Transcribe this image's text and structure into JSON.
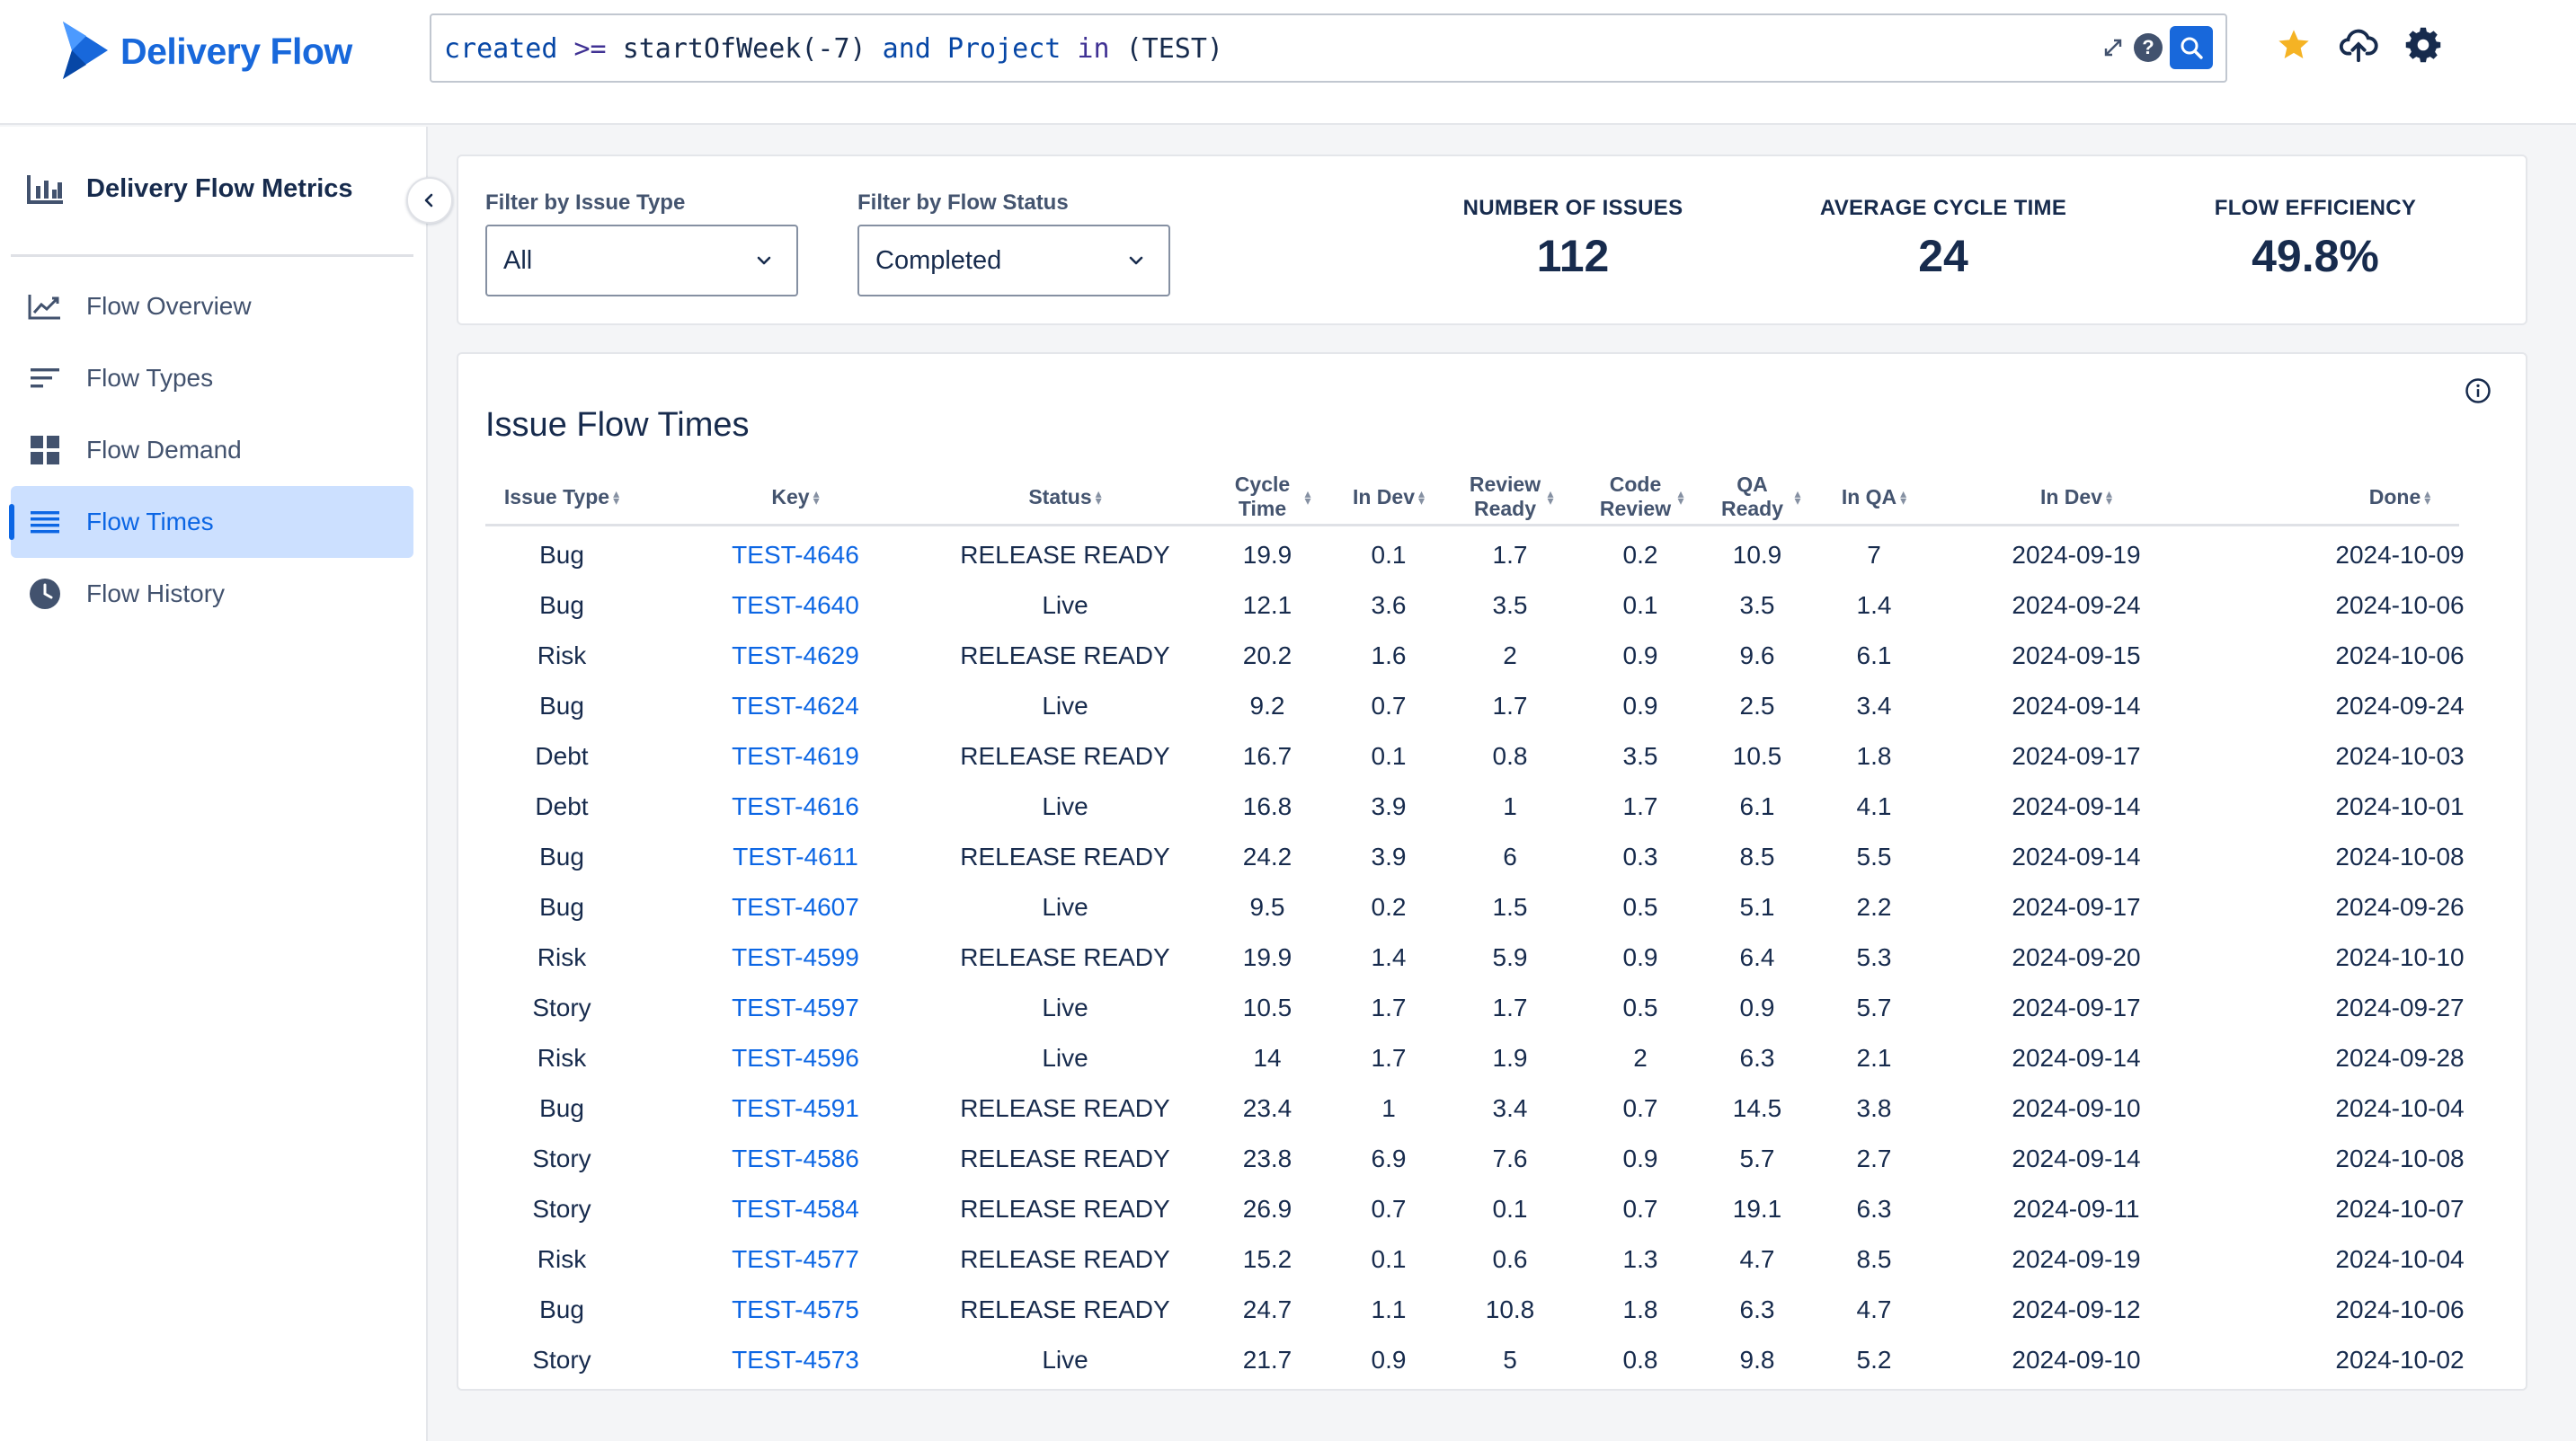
{
  "header": {
    "app_name": "Delivery Flow",
    "query": {
      "parts": [
        {
          "text": "created",
          "cls": "q-field"
        },
        {
          "text": " >= ",
          "cls": "q-op"
        },
        {
          "text": "startOfWeek(-7)",
          "cls": "q-fn"
        },
        {
          "text": " and ",
          "cls": "q-kw"
        },
        {
          "text": "Project",
          "cls": "q-field"
        },
        {
          "text": " in ",
          "cls": "q-op"
        },
        {
          "text": "(TEST)",
          "cls": "q-fn"
        }
      ]
    },
    "icons": [
      "star-icon",
      "cloud-upload-icon",
      "gear-icon"
    ],
    "colors": {
      "brand": "#1868DB",
      "star": "#F5B324"
    }
  },
  "sidebar": {
    "title": "Delivery Flow Metrics",
    "items": [
      {
        "label": "Flow Overview",
        "icon": "line-chart-icon",
        "active": false
      },
      {
        "label": "Flow Types",
        "icon": "lines-icon",
        "active": false
      },
      {
        "label": "Flow Demand",
        "icon": "grid-icon",
        "active": false
      },
      {
        "label": "Flow Times",
        "icon": "list-icon",
        "active": true
      },
      {
        "label": "Flow History",
        "icon": "clock-icon",
        "active": false
      }
    ]
  },
  "filters": {
    "issue_type": {
      "label": "Filter by Issue Type",
      "value": "All"
    },
    "flow_status": {
      "label": "Filter by Flow Status",
      "value": "Completed"
    }
  },
  "metrics": [
    {
      "label": "NUMBER OF ISSUES",
      "value": "112"
    },
    {
      "label": "AVERAGE CYCLE TIME",
      "value": "24"
    },
    {
      "label": "FLOW EFFICIENCY",
      "value": "49.8%"
    }
  ],
  "table": {
    "title": "Issue Flow Times",
    "columns": [
      "Issue Type",
      "Key",
      "Status",
      "Cycle Time",
      "In Dev",
      "Review Ready",
      "Code Review",
      "QA Ready",
      "In QA",
      "In Dev",
      "Done"
    ],
    "rows": [
      [
        "Bug",
        "TEST-4646",
        "RELEASE READY",
        "19.9",
        "0.1",
        "1.7",
        "0.2",
        "10.9",
        "7",
        "2024-09-19",
        "2024-10-09"
      ],
      [
        "Bug",
        "TEST-4640",
        "Live",
        "12.1",
        "3.6",
        "3.5",
        "0.1",
        "3.5",
        "1.4",
        "2024-09-24",
        "2024-10-06"
      ],
      [
        "Risk",
        "TEST-4629",
        "RELEASE READY",
        "20.2",
        "1.6",
        "2",
        "0.9",
        "9.6",
        "6.1",
        "2024-09-15",
        "2024-10-06"
      ],
      [
        "Bug",
        "TEST-4624",
        "Live",
        "9.2",
        "0.7",
        "1.7",
        "0.9",
        "2.5",
        "3.4",
        "2024-09-14",
        "2024-09-24"
      ],
      [
        "Debt",
        "TEST-4619",
        "RELEASE READY",
        "16.7",
        "0.1",
        "0.8",
        "3.5",
        "10.5",
        "1.8",
        "2024-09-17",
        "2024-10-03"
      ],
      [
        "Debt",
        "TEST-4616",
        "Live",
        "16.8",
        "3.9",
        "1",
        "1.7",
        "6.1",
        "4.1",
        "2024-09-14",
        "2024-10-01"
      ],
      [
        "Bug",
        "TEST-4611",
        "RELEASE READY",
        "24.2",
        "3.9",
        "6",
        "0.3",
        "8.5",
        "5.5",
        "2024-09-14",
        "2024-10-08"
      ],
      [
        "Bug",
        "TEST-4607",
        "Live",
        "9.5",
        "0.2",
        "1.5",
        "0.5",
        "5.1",
        "2.2",
        "2024-09-17",
        "2024-09-26"
      ],
      [
        "Risk",
        "TEST-4599",
        "RELEASE READY",
        "19.9",
        "1.4",
        "5.9",
        "0.9",
        "6.4",
        "5.3",
        "2024-09-20",
        "2024-10-10"
      ],
      [
        "Story",
        "TEST-4597",
        "Live",
        "10.5",
        "1.7",
        "1.7",
        "0.5",
        "0.9",
        "5.7",
        "2024-09-17",
        "2024-09-27"
      ],
      [
        "Risk",
        "TEST-4596",
        "Live",
        "14",
        "1.7",
        "1.9",
        "2",
        "6.3",
        "2.1",
        "2024-09-14",
        "2024-09-28"
      ],
      [
        "Bug",
        "TEST-4591",
        "RELEASE READY",
        "23.4",
        "1",
        "3.4",
        "0.7",
        "14.5",
        "3.8",
        "2024-09-10",
        "2024-10-04"
      ],
      [
        "Story",
        "TEST-4586",
        "RELEASE READY",
        "23.8",
        "6.9",
        "7.6",
        "0.9",
        "5.7",
        "2.7",
        "2024-09-14",
        "2024-10-08"
      ],
      [
        "Story",
        "TEST-4584",
        "RELEASE READY",
        "26.9",
        "0.7",
        "0.1",
        "0.7",
        "19.1",
        "6.3",
        "2024-09-11",
        "2024-10-07"
      ],
      [
        "Risk",
        "TEST-4577",
        "RELEASE READY",
        "15.2",
        "0.1",
        "0.6",
        "1.3",
        "4.7",
        "8.5",
        "2024-09-19",
        "2024-10-04"
      ],
      [
        "Bug",
        "TEST-4575",
        "RELEASE READY",
        "24.7",
        "1.1",
        "10.8",
        "1.8",
        "6.3",
        "4.7",
        "2024-09-12",
        "2024-10-06"
      ],
      [
        "Story",
        "TEST-4573",
        "Live",
        "21.7",
        "0.9",
        "5",
        "0.8",
        "9.8",
        "5.2",
        "2024-09-10",
        "2024-10-02"
      ]
    ]
  }
}
